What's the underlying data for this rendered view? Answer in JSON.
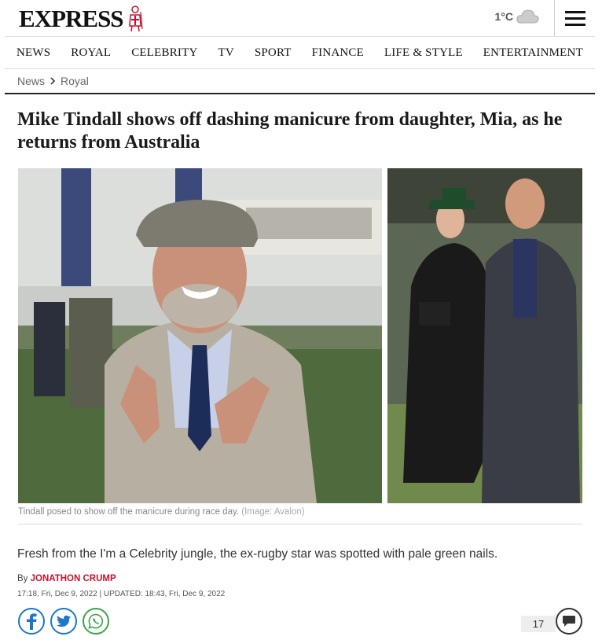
{
  "brand": {
    "logo_text": "EXPRESS"
  },
  "weather": {
    "temperature": "1°C",
    "icon": "cloud-icon"
  },
  "nav": {
    "items": [
      "NEWS",
      "ROYAL",
      "CELEBRITY",
      "TV",
      "SPORT",
      "FINANCE",
      "LIFE & STYLE",
      "ENTERTAINMENT"
    ]
  },
  "breadcrumb": {
    "parent": "News",
    "current": "Royal"
  },
  "article": {
    "headline": "Mike Tindall shows off dashing manicure from daughter, Mia, as he returns from Australia",
    "caption": "Tindall posed to show off the manicure during race day.",
    "caption_credit": "(Image: Avalon)",
    "standfirst": "Fresh from the I'm a Celebrity jungle, the ex-rugby star was spotted with pale green nails.",
    "byline_prefix": "By",
    "author": "JONATHON CRUMP",
    "dates": "17:18, Fri, Dec 9, 2022 | UPDATED: 18:43, Fri, Dec 9, 2022",
    "comment_count": "17"
  },
  "colors": {
    "accent_red": "#c8102e",
    "share_blue": "#1c78c6",
    "whatsapp_green": "#3aa54a"
  }
}
